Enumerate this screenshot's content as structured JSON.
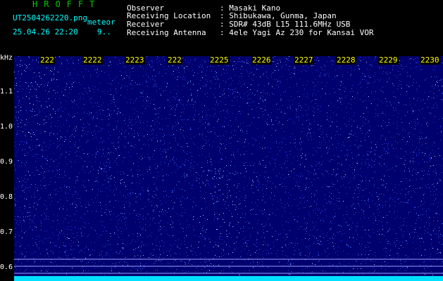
{
  "header": {
    "logo": "HROFFT",
    "filename": "UT2504262220.png",
    "tag": "meteor",
    "datetime": "25.04.26 22:20",
    "count": "9..",
    "info": [
      {
        "label": "Observer",
        "value": ": Masaki Kano"
      },
      {
        "label": "Receiving Location",
        "value": ": Shibukawa, Gunma, Japan"
      },
      {
        "label": "Receiver",
        "value": ": SDR# 43dB L15 111.6MHz USB"
      },
      {
        "label": "Receiving Antenna",
        "value": ": 4ele Yagi Az 230 for Kansai VOR"
      }
    ]
  },
  "axis": {
    "unit": "kHz",
    "y_labels": [
      "1.1",
      "1.0",
      "0.9",
      "0.8",
      "0.7",
      "0.6"
    ],
    "x_labels": [
      "222",
      "2222",
      "2223",
      "222",
      "2225",
      "2226",
      "2227",
      "2228",
      "2229",
      "2230"
    ]
  },
  "colors": {
    "background": "#000000",
    "spectrogram_base": "#000078",
    "noise": "#3050ff",
    "text_green": "#00c800",
    "text_cyan": "#00ffff",
    "text_yellow": "#ffff00"
  }
}
